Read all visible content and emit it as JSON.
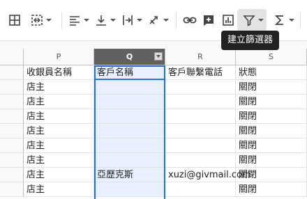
{
  "toolbar": {
    "items": [
      {
        "name": "borders-icon"
      },
      {
        "name": "merge-cells-icon"
      },
      {
        "name": "horizontal-align-icon"
      },
      {
        "name": "vertical-align-icon"
      },
      {
        "name": "text-wrapping-icon"
      },
      {
        "name": "text-rotation-icon"
      },
      {
        "name": "insert-link-icon"
      },
      {
        "name": "insert-comment-icon"
      },
      {
        "name": "insert-chart-icon"
      },
      {
        "name": "filter-icon"
      },
      {
        "name": "functions-icon"
      }
    ],
    "tooltip": "建立篩選器"
  },
  "columns": [
    "P",
    "Q",
    "R",
    "S"
  ],
  "selected_column": "Q",
  "header_row": [
    "收銀員名稱",
    "客戶名稱",
    "客戶聯繫電話",
    "狀態"
  ],
  "rows": [
    [
      "店主",
      "",
      "",
      "關閉"
    ],
    [
      "店主",
      "",
      "",
      "關閉"
    ],
    [
      "店主",
      "",
      "",
      "關閉"
    ],
    [
      "店主",
      "",
      "",
      "關閉"
    ],
    [
      "店主",
      "",
      "",
      "關閉"
    ],
    [
      "店主",
      "",
      "",
      "關閉"
    ],
    [
      "店主",
      "亞歷克斯",
      "xuzi@givmail.com",
      "關閉"
    ],
    [
      "店主",
      "",
      "",
      "關閉"
    ]
  ]
}
